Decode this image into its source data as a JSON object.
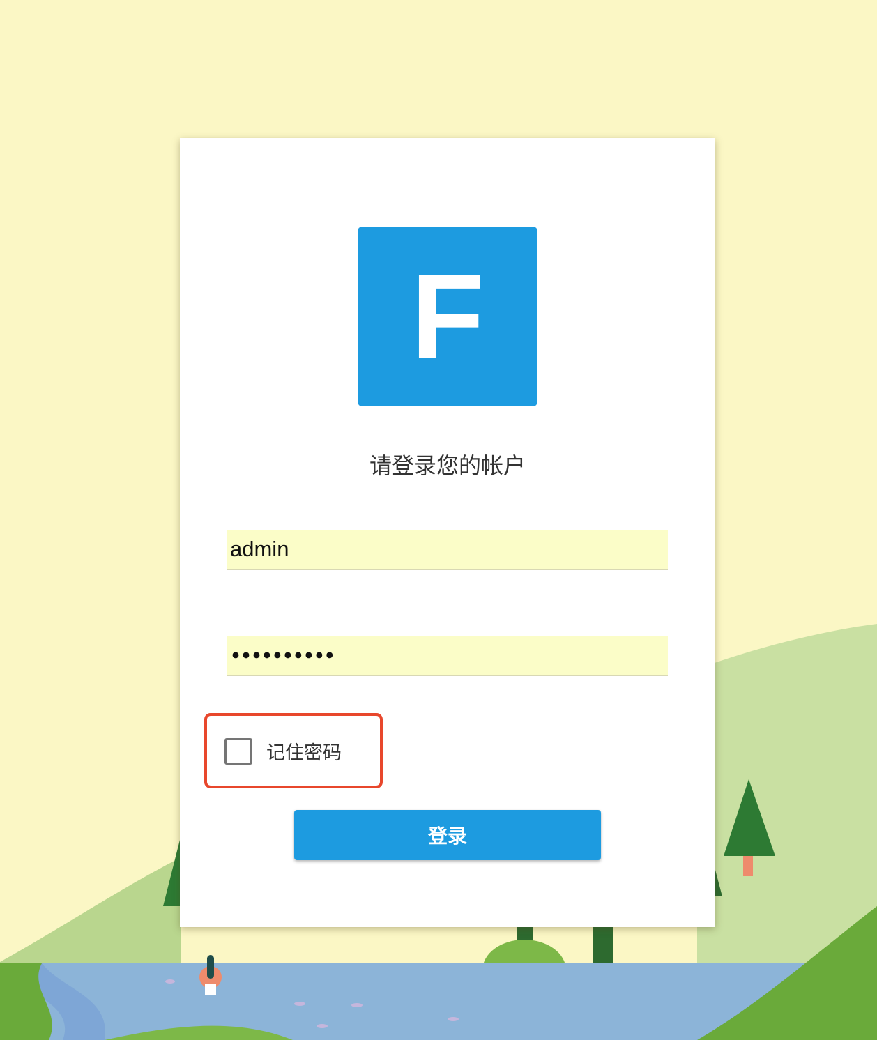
{
  "logo": {
    "letter": "F"
  },
  "login": {
    "subtitle": "请登录您的帐户",
    "username_value": "admin",
    "password_mask": "••••••••••",
    "remember_label": "记住密码",
    "remember_checked": false,
    "submit_label": "登录"
  },
  "colors": {
    "background": "#fbf7c5",
    "brand_blue": "#1d9be0",
    "input_fill": "#fbfdc8",
    "highlight": "#e8472c",
    "hill_light": "#c9e0a2",
    "hill_dark": "#6aaa3a",
    "water": "#8cb4d8"
  }
}
